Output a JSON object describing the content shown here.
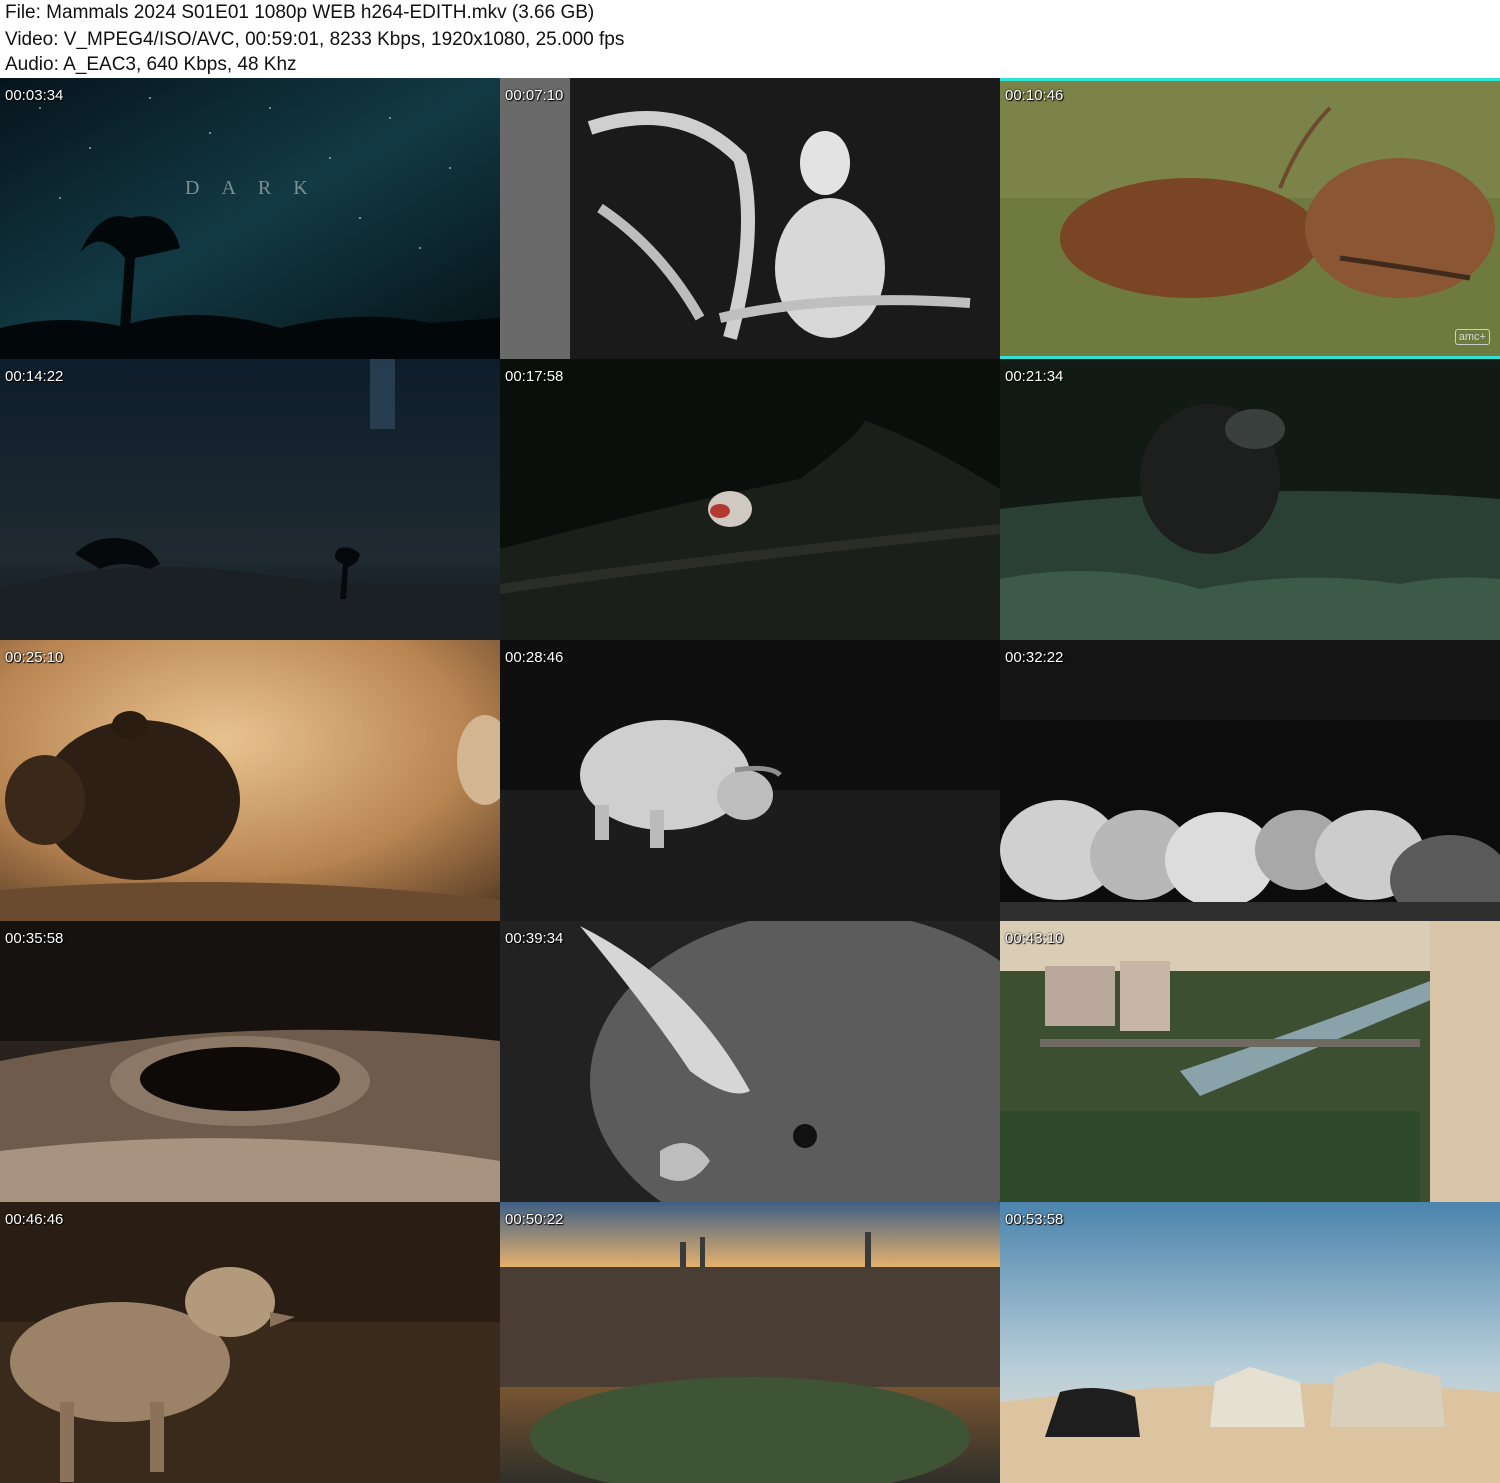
{
  "header": {
    "file_line": "File: Mammals 2024 S01E01 1080p WEB h264-EDITH.mkv (3.66 GB)",
    "video_line": "Video: V_MPEG4/ISO/AVC, 00:59:01, 8233 Kbps, 1920x1080, 25.000 fps",
    "audio_line": "Audio: A_EAC3, 640 Kbps, 48 Khz"
  },
  "frames": [
    {
      "timestamp": "00:03:34",
      "overlay_text": "DARK"
    },
    {
      "timestamp": "00:07:10"
    },
    {
      "timestamp": "00:10:46",
      "logo_text": "amc+"
    },
    {
      "timestamp": "00:14:22"
    },
    {
      "timestamp": "00:17:58"
    },
    {
      "timestamp": "00:21:34"
    },
    {
      "timestamp": "00:25:10"
    },
    {
      "timestamp": "00:28:46"
    },
    {
      "timestamp": "00:32:22"
    },
    {
      "timestamp": "00:35:58"
    },
    {
      "timestamp": "00:39:34"
    },
    {
      "timestamp": "00:43:10"
    },
    {
      "timestamp": "00:46:46"
    },
    {
      "timestamp": "00:50:22"
    },
    {
      "timestamp": "00:53:58"
    }
  ],
  "colors": {
    "page_background": "#ffffff",
    "header_text": "#111111",
    "timestamp_text": "#ffffff",
    "accent_bar": "#2fe3d2"
  }
}
